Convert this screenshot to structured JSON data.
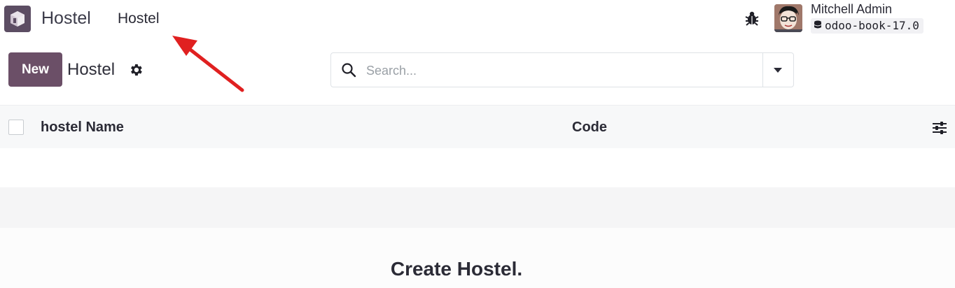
{
  "topbar": {
    "app_icon": "hostel-app-icon",
    "brand": "Hostel",
    "menu_item": "Hostel",
    "debug_icon": "bug-icon",
    "user": {
      "name": "Mitchell Admin",
      "database": "odoo-book-17.0"
    }
  },
  "control_panel": {
    "new_label": "New",
    "breadcrumb": "Hostel",
    "settings_icon": "gear-icon",
    "search": {
      "placeholder": "Search..."
    }
  },
  "list": {
    "columns": [
      "hostel Name",
      "Code"
    ],
    "optional_columns_icon": "sliders-icon"
  },
  "helper": {
    "title": "Create Hostel."
  },
  "annotation": {
    "arrow_color": "#e02020"
  },
  "colors": {
    "primary": "#6b4f67",
    "app_icon_bg": "#5c4d63"
  }
}
